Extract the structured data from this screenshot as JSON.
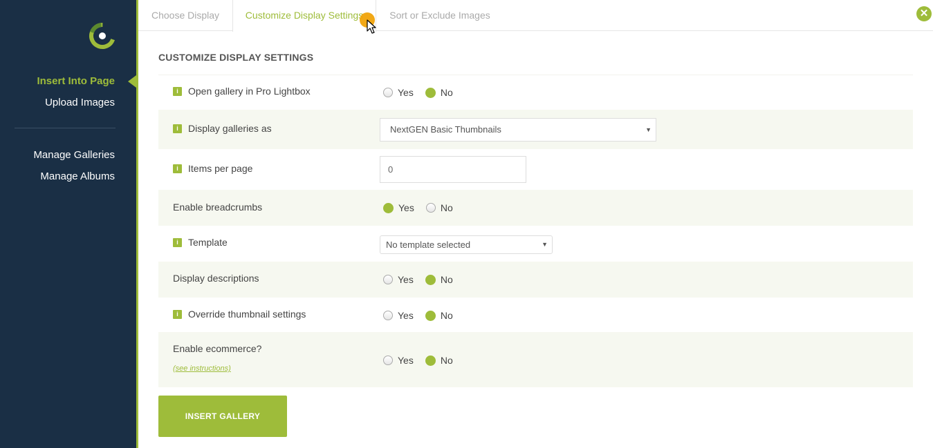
{
  "sidebar": {
    "logo": "nextgen-logo",
    "nav_primary": [
      {
        "label": "Insert Into Page",
        "active": true
      },
      {
        "label": "Upload Images",
        "active": false
      }
    ],
    "nav_secondary": [
      {
        "label": "Manage Galleries"
      },
      {
        "label": "Manage Albums"
      }
    ]
  },
  "tabs": [
    {
      "label": "Choose Display",
      "active": false
    },
    {
      "label": "Customize Display Settings",
      "active": true
    },
    {
      "label": "Sort or Exclude Images",
      "active": false
    }
  ],
  "close_icon": "close-icon",
  "main": {
    "section_title": "CUSTOMIZE DISPLAY SETTINGS",
    "settings": [
      {
        "label": "Open gallery in Pro Lightbox",
        "info": true,
        "control": "radio",
        "yes": "Yes",
        "no": "No",
        "selected": "No"
      },
      {
        "label": "Display galleries as",
        "info": true,
        "control": "select",
        "value": "NextGEN Basic Thumbnails"
      },
      {
        "label": "Items per page",
        "info": true,
        "control": "input",
        "value": "0"
      },
      {
        "label": "Enable breadcrumbs",
        "info": false,
        "control": "radio",
        "yes": "Yes",
        "no": "No",
        "selected": "Yes"
      },
      {
        "label": "Template",
        "info": true,
        "control": "select",
        "value": "No template selected"
      },
      {
        "label": "Display descriptions",
        "info": false,
        "control": "radio",
        "yes": "Yes",
        "no": "No",
        "selected": "No"
      },
      {
        "label": "Override thumbnail settings",
        "info": true,
        "control": "radio",
        "yes": "Yes",
        "no": "No",
        "selected": "No"
      },
      {
        "label": "Enable ecommerce?",
        "info": false,
        "control": "radio",
        "yes": "Yes",
        "no": "No",
        "selected": "No",
        "link": "(see instructions)"
      }
    ],
    "info_icon_glyph": "i",
    "insert_button": "INSERT GALLERY"
  },
  "colors": {
    "accent": "#9ebc3a",
    "sidebar_bg": "#1a2f45",
    "cursor_highlight": "#f0a30a"
  }
}
